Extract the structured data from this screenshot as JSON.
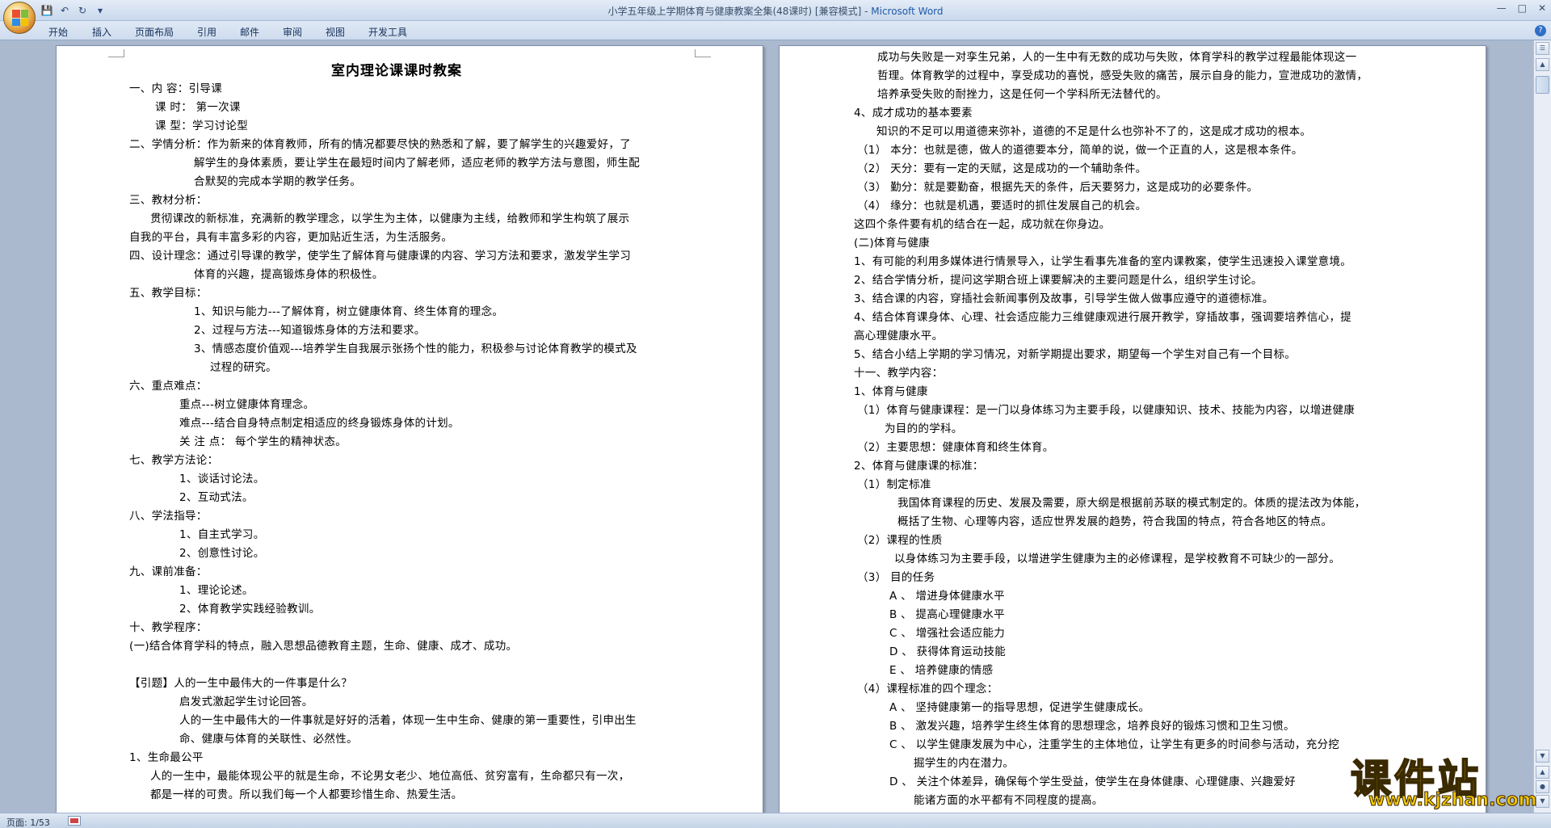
{
  "window": {
    "title": "小学五年级上学期体育与健康教案全集(48课时) [兼容模式] - ",
    "app_name": "Microsoft Word"
  },
  "ribbon": {
    "tabs": [
      "开始",
      "插入",
      "页面布局",
      "引用",
      "邮件",
      "审阅",
      "视图",
      "开发工具"
    ]
  },
  "status": {
    "page_count": "页面: 1/53"
  },
  "watermark": {
    "title": "课件站",
    "url": "www.kjzhan.com"
  },
  "page1": {
    "heading": "室内理论课课时教案",
    "lines": [
      "一、内      容：引导课         ",
      "课      时：  第一次课",
      "课      型：学习讨论型",
      "二、学情分析：作为新来的体育教师，所有的情况都要尽快的熟悉和了解，要了解学生的兴趣爱好，了",
      "解学生的身体素质，要让学生在最短时间内了解老师，适应老师的教学方法与意图，师生配",
      "合默契的完成本学期的教学任务。",
      "三、教材分析：",
      "贯彻课改的新标准，充满新的教学理念，以学生为主体，以健康为主线，给教师和学生构筑了展示",
      "自我的平台，具有丰富多彩的内容，更加贴近生活，为生活服务。",
      "四、设计理念：通过引导课的教学，使学生了解体育与健康课的内容、学习方法和要求，激发学生学习",
      "体育的兴趣，提高锻炼身体的积极性。",
      "五、教学目标：",
      "1、知识与能力---了解体育，树立健康体育、终生体育的理念。",
      "2、过程与方法---知道锻炼身体的方法和要求。",
      "3、情感态度价值观---培养学生自我展示张扬个性的能力，积极参与讨论体育教学的模式及",
      "过程的研究。",
      "六、重点难点：",
      "重点---树立健康体育理念。",
      "难点---结合自身特点制定相适应的终身锻炼身体的计划。",
      "关  注  点：  每个学生的精神状态。",
      "七、教学方法论：",
      "1、谈话讨论法。",
      "2、互动式法。",
      "八、学法指导：",
      "1、自主式学习。",
      "2、创意性讨论。",
      "九、课前准备：",
      "1、理论论述。",
      "2、体育教学实践经验教训。",
      "十、教学程序：    ",
      "(一)结合体育学科的特点，融入思想品德教育主题，生命、健康、成才、成功。",
      "",
      "【引题】人的一生中最伟大的一件事是什么？",
      "启发式激起学生讨论回答。",
      "人的一生中最伟大的一件事就是好好的活着，体现一生中生命、健康的第一重要性，引申出生",
      "命、健康与体育的关联性、必然性。",
      "1、生命最公平",
      "人的一生中，最能体现公平的就是生命，不论男女老少、地位高低、贫穷富有，生命都只有一次，",
      "都是一样的可贵。所以我们每一个人都要珍惜生命、热爱生活。"
    ]
  },
  "page2": {
    "lines": [
      "成功与失败是一对孪生兄弟，人的一生中有无数的成功与失败，体育学科的教学过程最能体现这一",
      "哲理。体育教学的过程中，享受成功的喜悦，感受失败的痛苦，展示自身的能力，宣泄成功的激情，",
      "培养承受失败的耐挫力，这是任何一个学科所无法替代的。",
      "4、成才成功的基本要素",
      "知识的不足可以用道德来弥补，道德的不足是什么也弥补不了的，这是成才成功的根本。",
      "（1）    本分：也就是德，做人的道德要本分，简单的说，做一个正直的人，这是根本条件。",
      "（2）    天分：要有一定的天赋，这是成功的一个辅助条件。",
      "（3）    勤分：就是要勤奋，根据先天的条件，后天要努力，这是成功的必要条件。",
      "（4）    缘分：也就是机遇，要适时的抓住发展自己的机会。",
      "这四个条件要有机的结合在一起，成功就在你身边。   ",
      "(二)体育与健康   ",
      "1、有可能的利用多媒体进行情景导入，让学生看事先准备的室内课教案，使学生迅速投入课堂意境。",
      "2、结合学情分析，提问这学期合班上课要解决的主要问题是什么，组织学生讨论。",
      "3、结合课的内容，穿插社会新闻事例及故事，引导学生做人做事应遵守的道德标准。",
      "4、结合体育课身体、心理、社会适应能力三维健康观进行展开教学，穿插故事，强调要培养信心，提",
      "高心理健康水平。",
      "5、结合小结上学期的学习情况，对新学期提出要求，期望每一个学生对自己有一个目标。",
      "十一、教学内容：",
      "1、体育与健康",
      "（1）体育与健康课程：是一门以身体练习为主要手段，以健康知识、技术、技能为内容，以增进健康",
      "为目的的学科。",
      "（2）主要思想：健康体育和终生体育。",
      "2、体育与健康课的标准：",
      "（1）制定标准",
      "我国体育课程的历史、发展及需要，原大纲是根据前苏联的模式制定的。体质的提法改为体能，",
      "概括了生物、心理等内容，适应世界发展的趋势，符合我国的特点，符合各地区的特点。",
      "（2）课程的性质",
      "以身体练习为主要手段，以增进学生健康为主的必修课程，是学校教育不可缺少的一部分。",
      "（3） 目的任务",
      "A  、    增进身体健康水平",
      "B  、    提高心理健康水平",
      "C    、  增强社会适应能力",
      "D    、  获得体育运动技能",
      "E    、  培养健康的情感",
      "（4）课程标准的四个理念：",
      "A      、  坚持健康第一的指导思想，促进学生健康成长。",
      "B      、  激发兴趣，培养学生终生体育的思想理念，培养良好的锻炼习惯和卫生习惯。",
      "C      、  以学生健康发展为中心，注重学生的主体地位，让学生有更多的时间参与活动，充分挖",
      "掘学生的内在潜力。",
      "D      、  关注个体差异，确保每个学生受益，使学生在身体健康、心理健康、兴趣爱好",
      "能诸方面的水平都有不同程度的提高。"
    ]
  }
}
